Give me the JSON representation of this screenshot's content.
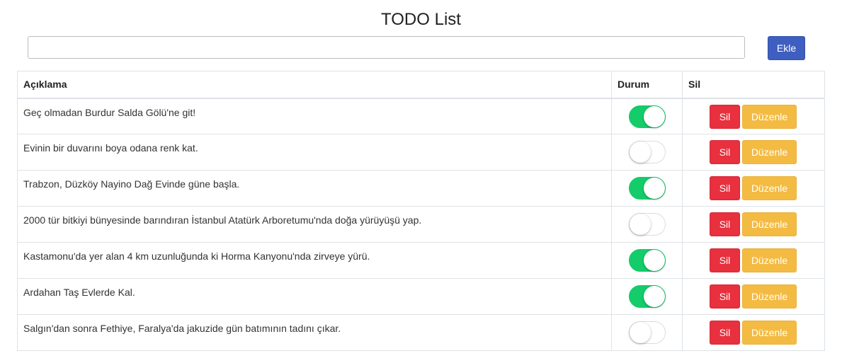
{
  "header": {
    "title": "TODO List"
  },
  "new_todo": {
    "value": "",
    "placeholder": "",
    "add_label": "Ekle"
  },
  "table": {
    "columns": [
      "Açıklama",
      "Durum",
      "Sil"
    ],
    "delete_label": "Sil",
    "edit_label": "Düzenle",
    "rows": [
      {
        "description": "Geç olmadan Burdur Salda Gölü'ne git!",
        "done": true
      },
      {
        "description": "Evinin bir duvarını boya odana renk kat.",
        "done": false
      },
      {
        "description": "Trabzon, Düzköy Nayino Dağ Evinde güne başla.",
        "done": true
      },
      {
        "description": "2000 tür bitkiyi bünyesinde barındıran İstanbul Atatürk Arboretumu'nda doğa yürüyüşü yap.",
        "done": false
      },
      {
        "description": "Kastamonu'da yer alan 4 km uzunluğunda ki Horma Kanyonu'nda zirveye yürü.",
        "done": true
      },
      {
        "description": "Ardahan Taş Evlerde Kal.",
        "done": true
      },
      {
        "description": "Salgın'dan sonra Fethiye, Faralya'da jakuzide gün batımının tadını çıkar.",
        "done": false
      }
    ]
  },
  "colors": {
    "add_button": "#3f5fc0",
    "toggle_on": "#14cc6a",
    "delete_button": "#e8303f",
    "edit_button": "#f4bb43"
  }
}
